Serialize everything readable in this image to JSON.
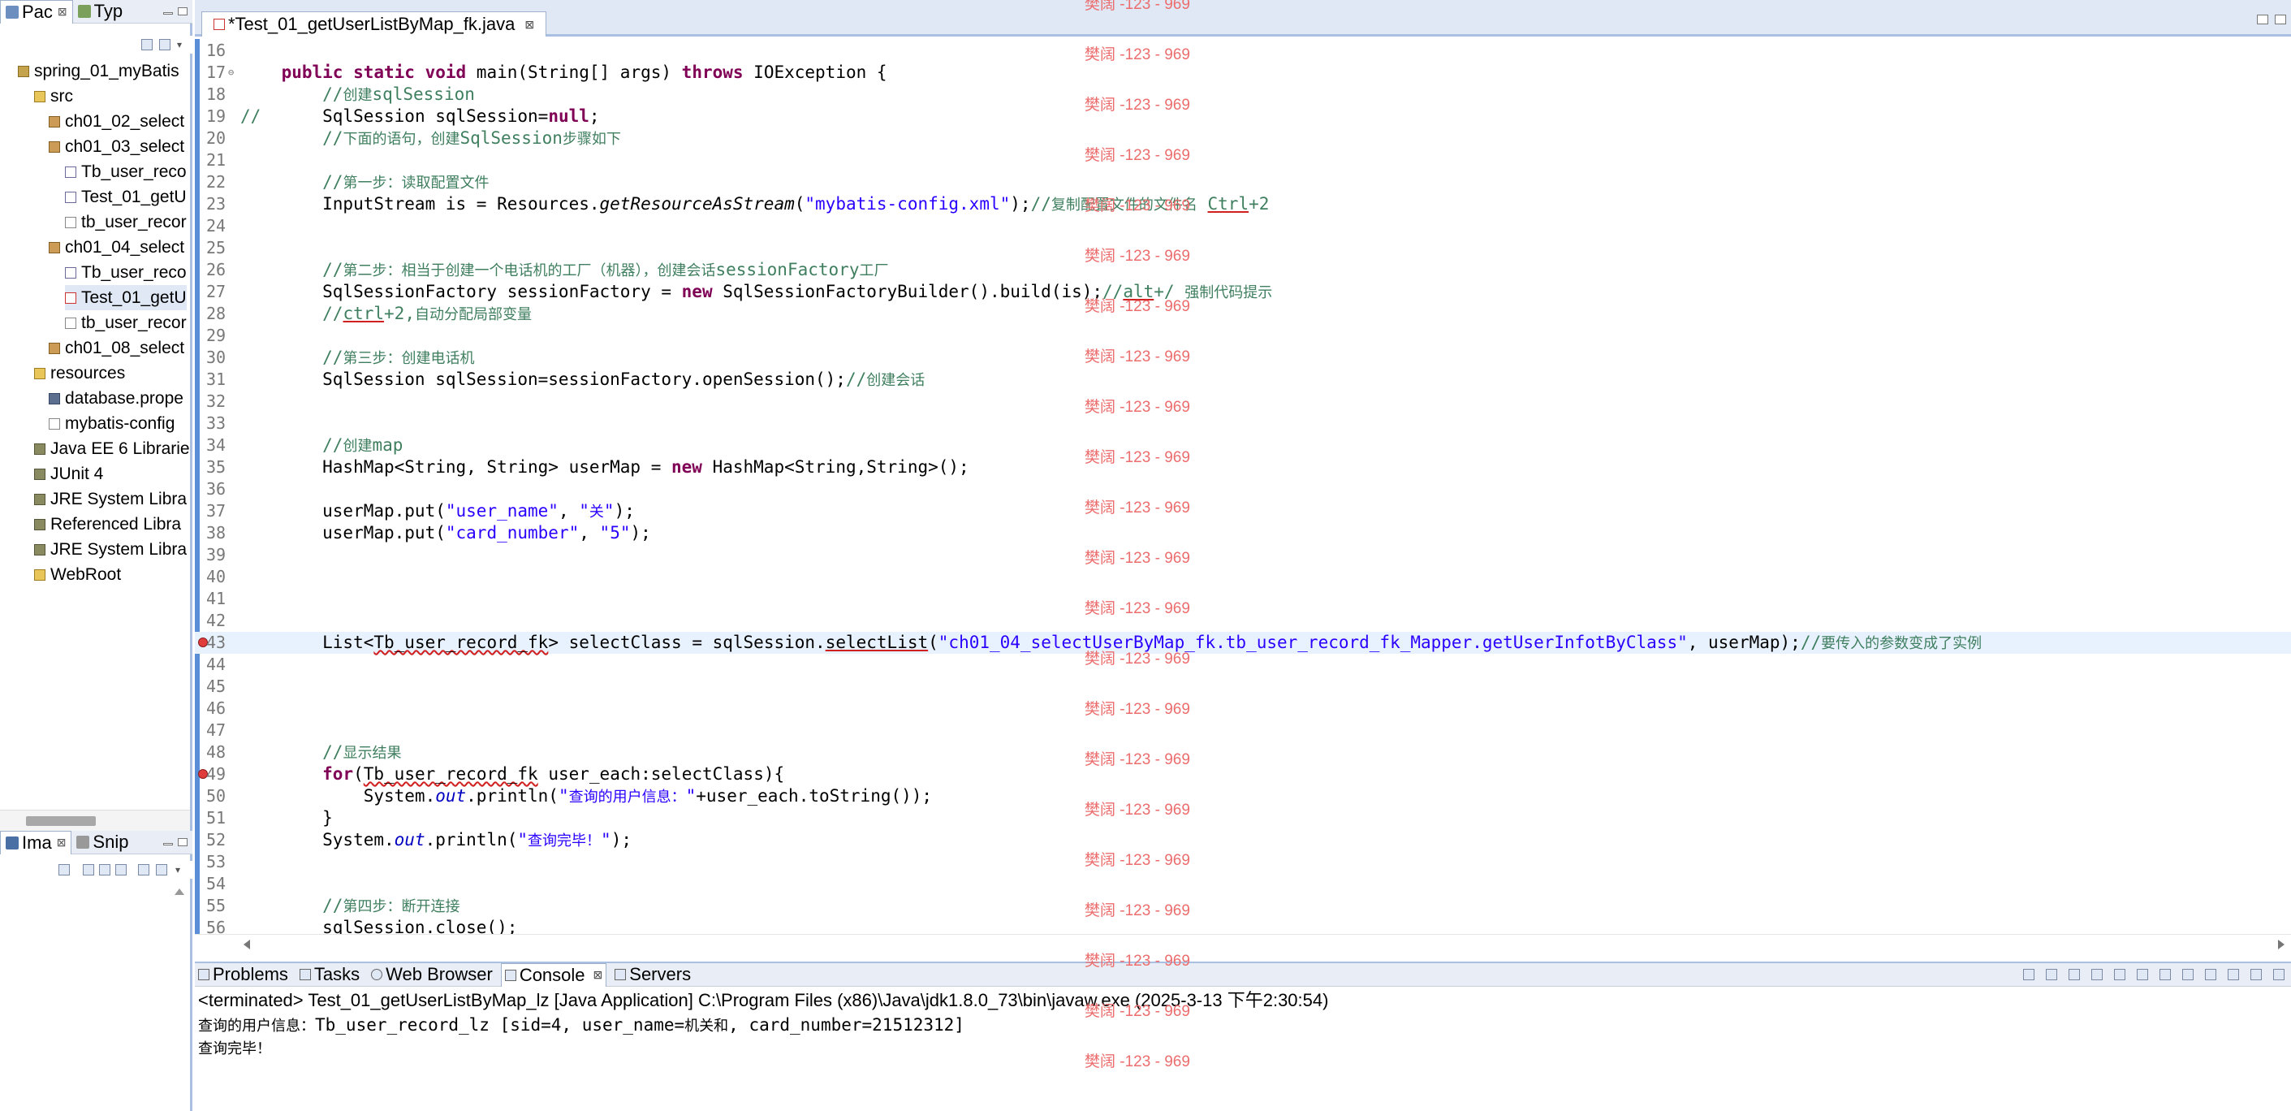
{
  "left_panel": {
    "tabs": [
      {
        "label": "Pac",
        "close": "⊠"
      },
      {
        "label": "Typ"
      }
    ],
    "tree": [
      {
        "label": "spring_01_myBatis",
        "icon": "project",
        "level": 0
      },
      {
        "label": "src",
        "icon": "folder",
        "level": 1
      },
      {
        "label": "ch01_02_select",
        "icon": "package",
        "level": 2
      },
      {
        "label": "ch01_03_select",
        "icon": "package",
        "level": 2
      },
      {
        "label": "Tb_user_reco",
        "icon": "java",
        "level": 3
      },
      {
        "label": "Test_01_getU",
        "icon": "java",
        "level": 3
      },
      {
        "label": "tb_user_recor",
        "icon": "xml",
        "level": 3
      },
      {
        "label": "ch01_04_select",
        "icon": "package",
        "level": 2
      },
      {
        "label": "Tb_user_reco",
        "icon": "java",
        "level": 3
      },
      {
        "label": "Test_01_getU",
        "icon": "java-err",
        "level": 3,
        "selected": true
      },
      {
        "label": "tb_user_recor",
        "icon": "xml",
        "level": 3
      },
      {
        "label": "ch01_08_select",
        "icon": "package",
        "level": 2
      },
      {
        "label": "resources",
        "icon": "folder",
        "level": 1
      },
      {
        "label": "database.prope",
        "icon": "props",
        "level": 2
      },
      {
        "label": "mybatis-config",
        "icon": "xml",
        "level": 2
      },
      {
        "label": "Java EE 6 Librarie",
        "icon": "lib",
        "level": 1
      },
      {
        "label": "JUnit 4",
        "icon": "lib",
        "level": 1
      },
      {
        "label": "JRE System Libra",
        "icon": "lib",
        "level": 1
      },
      {
        "label": "Referenced Libra",
        "icon": "lib",
        "level": 1
      },
      {
        "label": "JRE System Libra",
        "icon": "lib",
        "level": 1
      },
      {
        "label": "WebRoot",
        "icon": "web",
        "level": 1
      }
    ],
    "image_tabs": [
      {
        "label": "Ima",
        "close": "⊠"
      },
      {
        "label": "Snip"
      }
    ]
  },
  "editor": {
    "tab_label": "*Test_01_getUserListByMap_fk.java",
    "tab_close": "⊠",
    "lines": [
      {
        "n": "16",
        "html": ""
      },
      {
        "n": "17",
        "fold": "⊖",
        "html": "    <span class='kw'>public static void</span> main(String[] args) <span class='kw'>throws</span> IOException {"
      },
      {
        "n": "18",
        "html": "        <span class='cm'>//<span class='cmc'>创建</span>sqlSession</span>"
      },
      {
        "n": "19",
        "html": "<span class='cm'>//</span>      SqlSession sqlSession=<span class='kw'>null</span>;"
      },
      {
        "n": "20",
        "html": "        <span class='cm'>//<span class='cmc'>下面的语句，创建</span>SqlSession<span class='cmc'>步骤如下</span></span>"
      },
      {
        "n": "21",
        "html": ""
      },
      {
        "n": "22",
        "html": "        <span class='cm'>//<span class='cmc'>第一步：读取配置文件</span></span>"
      },
      {
        "n": "23",
        "html": "        InputStream is = Resources.<span class='mi'>getResourceAsStream</span>(<span class='str'>\"mybatis-config.xml\"</span>);<span class='cm'>//<span class='cmc'>复制配置文件的文件名</span> <span class='ul2'>Ctrl</span>+2</span>"
      },
      {
        "n": "24",
        "html": ""
      },
      {
        "n": "25",
        "html": ""
      },
      {
        "n": "26",
        "html": "        <span class='cm'>//<span class='cmc'>第二步：相当于创建一个电话机的工厂（机器），创建会话</span>sessionFactory<span class='cmc'>工厂</span></span>"
      },
      {
        "n": "27",
        "html": "        SqlSessionFactory sessionFactory = <span class='kw'>new</span> SqlSessionFactoryBuilder().build(is);<span class='cm'>//<span class='ul2'>alt</span>+/ <span class='cmc'>强制代码提示</span></span>"
      },
      {
        "n": "28",
        "html": "        <span class='cm'>//<span class='ul2'>ctrl</span>+2,<span class='cmc'>自动分配局部变量</span></span>"
      },
      {
        "n": "29",
        "html": ""
      },
      {
        "n": "30",
        "html": "        <span class='cm'>//<span class='cmc'>第三步：创建电话机</span></span>"
      },
      {
        "n": "31",
        "html": "        SqlSession sqlSession=sessionFactory.openSession();<span class='cm'>//<span class='cmc'>创建会话</span></span>"
      },
      {
        "n": "32",
        "html": ""
      },
      {
        "n": "33",
        "html": ""
      },
      {
        "n": "34",
        "html": "        <span class='cm'>//<span class='cmc'>创建</span>map</span>"
      },
      {
        "n": "35",
        "html": "        HashMap&lt;String, String&gt; userMap = <span class='kw'>new</span> HashMap&lt;String,String&gt;();"
      },
      {
        "n": "36",
        "html": ""
      },
      {
        "n": "37",
        "html": "        userMap.put(<span class='str'>\"user_name\"</span>, <span class='str'>\"<span class='stc'>关</span>\"</span>);"
      },
      {
        "n": "38",
        "html": "        userMap.put(<span class='str'>\"card_number\"</span>, <span class='str'>\"5\"</span>);"
      },
      {
        "n": "39",
        "html": ""
      },
      {
        "n": "40",
        "html": ""
      },
      {
        "n": "41",
        "html": ""
      },
      {
        "n": "42",
        "html": ""
      },
      {
        "n": "43",
        "marker": true,
        "current": true,
        "html": "        List&lt;<span class='ul'>Tb_user_record_fk</span>&gt; selectClass = sqlSession.<span class='ul2'>selectList</span>(<span class='str'>\"ch01_04_selectUserByMap_fk.tb_user_record_fk_Mapper.getUserInfotByClass\"</span>, userMap);<span class='cm'>//<span class='cmc'>要传入的参数变成了实例</span></span>"
      },
      {
        "n": "44",
        "html": ""
      },
      {
        "n": "45",
        "html": ""
      },
      {
        "n": "46",
        "html": ""
      },
      {
        "n": "47",
        "html": ""
      },
      {
        "n": "48",
        "html": "        <span class='cm'>//<span class='cmc'>显示结果</span></span>"
      },
      {
        "n": "49",
        "marker": true,
        "html": "        <span class='kw'>for</span>(<span class='ul'>Tb_user_record_fk</span> user_each:selectClass){"
      },
      {
        "n": "50",
        "html": "            System.<span class='fld'>out</span>.println(<span class='str'>\"<span class='stc'>查询的用户信息：</span>\"</span>+user_each.toString());"
      },
      {
        "n": "51",
        "html": "        }"
      },
      {
        "n": "52",
        "html": "        System.<span class='fld'>out</span>.println(<span class='str'>\"<span class='stc'>查询完毕！</span>\"</span>);"
      },
      {
        "n": "53",
        "html": ""
      },
      {
        "n": "54",
        "html": ""
      },
      {
        "n": "55",
        "html": "        <span class='cm'>//<span class='cmc'>第四步：断开连接</span></span>"
      },
      {
        "n": "56",
        "html": "        sqlSession.close();"
      }
    ]
  },
  "bottom_panel": {
    "tabs": [
      {
        "label": "Problems"
      },
      {
        "label": "Tasks"
      },
      {
        "label": "Web Browser"
      },
      {
        "label": "Console",
        "active": true,
        "close": "⊠"
      },
      {
        "label": "Servers"
      }
    ],
    "console_header": "<terminated> Test_01_getUserListByMap_lz [Java Application] C:\\Program Files (x86)\\Java\\jdk1.8.0_73\\bin\\javaw.exe (2025-3-13 下午2:30:54)",
    "console_lines": [
      "<span class='cn'>查询的用户信息：</span>Tb_user_record_lz [sid=4, user_name=<span class='cn'>机关和</span>, card_number=21512312]",
      "<span class='cn'>查询完毕！</span>"
    ]
  },
  "watermark": {
    "text": "樊阔 -123 - 969",
    "color": "#ec6d6d"
  },
  "colors": {
    "keyword": "#7f0055",
    "comment": "#3f7f5f",
    "string": "#2a00ff",
    "current_line": "#e8f2fe",
    "ruler": "#5a8fd8"
  }
}
